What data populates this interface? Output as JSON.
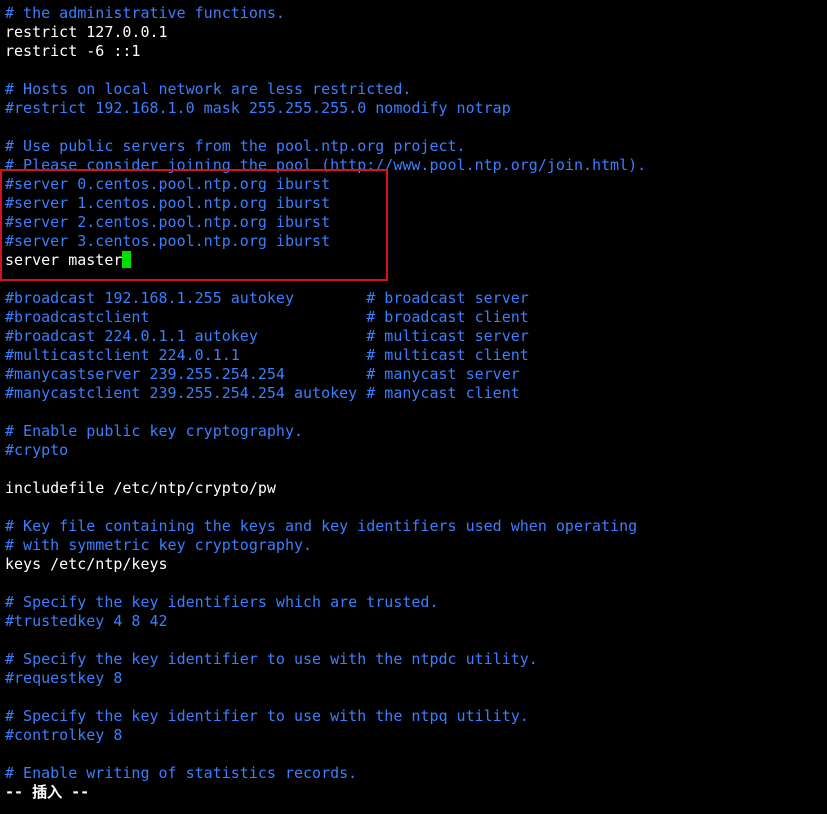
{
  "colors": {
    "background": "#000000",
    "comment": "#3a7fff",
    "plain": "#ffffff",
    "cursor": "#00e000",
    "highlight_box": "#d3151b"
  },
  "lines": [
    [
      {
        "t": "# the administrative functions.",
        "c": "comment"
      }
    ],
    [
      {
        "t": "restrict 127.0.0.1",
        "c": "plain"
      }
    ],
    [
      {
        "t": "restrict -6 ::1",
        "c": "plain"
      }
    ],
    [],
    [
      {
        "t": "# Hosts on local network are less restricted.",
        "c": "comment"
      }
    ],
    [
      {
        "t": "#restrict 192.168.1.0 mask 255.255.255.0 nomodify notrap",
        "c": "comment"
      }
    ],
    [],
    [
      {
        "t": "# Use public servers from the pool.ntp.org project.",
        "c": "comment"
      }
    ],
    [
      {
        "t": "# Please consider joining the pool (http://www.pool.ntp.org/join.html).",
        "c": "comment"
      }
    ],
    [
      {
        "t": "#server 0.centos.pool.ntp.org iburst",
        "c": "comment"
      }
    ],
    [
      {
        "t": "#server 1.centos.pool.ntp.org iburst",
        "c": "comment"
      }
    ],
    [
      {
        "t": "#server 2.centos.pool.ntp.org iburst",
        "c": "comment"
      }
    ],
    [
      {
        "t": "#server 3.centos.pool.ntp.org iburst",
        "c": "comment"
      }
    ],
    [
      {
        "t": "server master",
        "c": "plain"
      },
      {
        "cursor": true
      }
    ],
    [],
    [
      {
        "t": "#broadcast 192.168.1.255 autokey        # broadcast server",
        "c": "comment"
      }
    ],
    [
      {
        "t": "#broadcastclient                        # broadcast client",
        "c": "comment"
      }
    ],
    [
      {
        "t": "#broadcast 224.0.1.1 autokey            # multicast server",
        "c": "comment"
      }
    ],
    [
      {
        "t": "#multicastclient 224.0.1.1              # multicast client",
        "c": "comment"
      }
    ],
    [
      {
        "t": "#manycastserver 239.255.254.254         # manycast server",
        "c": "comment"
      }
    ],
    [
      {
        "t": "#manycastclient 239.255.254.254 autokey # manycast client",
        "c": "comment"
      }
    ],
    [],
    [
      {
        "t": "# Enable public key cryptography.",
        "c": "comment"
      }
    ],
    [
      {
        "t": "#crypto",
        "c": "comment"
      }
    ],
    [],
    [
      {
        "t": "includefile /etc/ntp/crypto/pw",
        "c": "plain"
      }
    ],
    [],
    [
      {
        "t": "# Key file containing the keys and key identifiers used when operating",
        "c": "comment"
      }
    ],
    [
      {
        "t": "# with symmetric key cryptography.",
        "c": "comment"
      }
    ],
    [
      {
        "t": "keys /etc/ntp/keys",
        "c": "plain"
      }
    ],
    [],
    [
      {
        "t": "# Specify the key identifiers which are trusted.",
        "c": "comment"
      }
    ],
    [
      {
        "t": "#trustedkey 4 8 42",
        "c": "comment"
      }
    ],
    [],
    [
      {
        "t": "# Specify the key identifier to use with the ntpdc utility.",
        "c": "comment"
      }
    ],
    [
      {
        "t": "#requestkey 8",
        "c": "comment"
      }
    ],
    [],
    [
      {
        "t": "# Specify the key identifier to use with the ntpq utility.",
        "c": "comment"
      }
    ],
    [
      {
        "t": "#controlkey 8",
        "c": "comment"
      }
    ],
    [],
    [
      {
        "t": "# Enable writing of statistics records.",
        "c": "comment"
      }
    ]
  ],
  "status": {
    "mode": "-- 插入 --"
  }
}
